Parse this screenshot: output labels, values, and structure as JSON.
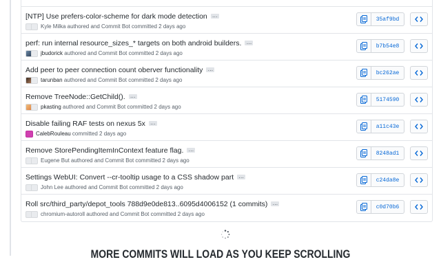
{
  "commits": [
    {
      "title": "[NTP] Use prefers-color-scheme for dark mode detection",
      "avatars": [
        "ghost",
        "ghost"
      ],
      "user": "",
      "meta": "Kyle Milka authored and Commit Bot committed 2 days ago",
      "sha": "35af9bd"
    },
    {
      "title": "perf: run internal resource_sizes_* targets on both android builders.",
      "avatars": [
        "photo1",
        "ghost"
      ],
      "user": "jbudorick",
      "meta": " authored and Commit Bot committed 2 days ago",
      "sha": "b7b54e8"
    },
    {
      "title": "Add peer to peer connection count oberver functionality",
      "avatars": [
        "photo2",
        "ghost"
      ],
      "user": "tarunban",
      "meta": " authored and Commit Bot committed 2 days ago",
      "sha": "bc262ae"
    },
    {
      "title": "Remove TreeNode::GetChild().",
      "avatars": [
        "photo3",
        "ghost"
      ],
      "user": "pkasting",
      "meta": " authored and Commit Bot committed 2 days ago",
      "sha": "5174590"
    },
    {
      "title": "Disable failing RAF tests on nexus 5x",
      "avatars": [
        "magenta"
      ],
      "user": "CalebRouleau",
      "meta": " committed 2 days ago",
      "sha": "a11c43e"
    },
    {
      "title": "Remove StorePendingItemInContext feature flag.",
      "avatars": [
        "ghost",
        "ghost"
      ],
      "user": "",
      "meta": "Eugene But authored and Commit Bot committed 2 days ago",
      "sha": "8248ad1"
    },
    {
      "title": "Settings WebUI: Convert --cr-tooltip usage to a CSS shadow part",
      "avatars": [
        "ghost",
        "ghost"
      ],
      "user": "",
      "meta": "John Lee authored and Commit Bot committed 2 days ago",
      "sha": "c24da8e"
    },
    {
      "title": "Roll src/third_party/depot_tools 788d9e0de813..6095d4006152 (1 commits)",
      "avatars": [
        "ghost",
        "ghost"
      ],
      "user": "",
      "meta": "chromium-autoroll authored and Commit Bot committed 2 days ago",
      "sha": "c0d70b6"
    }
  ],
  "footer": {
    "loading_text": "MORE COMMITS WILL LOAD AS YOU KEEP SCROLLING"
  },
  "icons": {
    "copy": "clipboard-icon",
    "browse": "code-icon",
    "ellipsis": "ellipsis-icon",
    "spinner": "spinner-icon"
  },
  "colors": {
    "link": "#0366d6",
    "text": "#24292e",
    "muted": "#586069",
    "border": "#e1e4e8"
  }
}
